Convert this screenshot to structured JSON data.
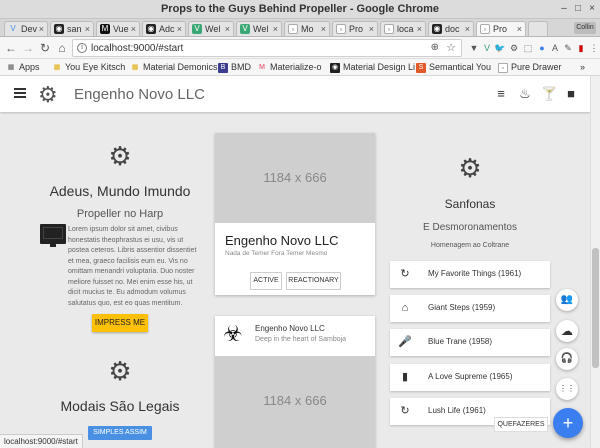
{
  "window": {
    "title": "Props to the Guys Behind Propeller - Google Chrome",
    "user": "Collin",
    "controls": [
      "–",
      "□",
      "×"
    ]
  },
  "tabs": [
    {
      "label": "Dev",
      "fav": "V",
      "fav_icon": "vuetify-icon"
    },
    {
      "label": "san",
      "fav": "◉",
      "fav_icon": "github-icon"
    },
    {
      "label": "Vue",
      "fav": "M",
      "fav_icon": "medium-icon"
    },
    {
      "label": "Adc",
      "fav": "◉",
      "fav_icon": "github-icon"
    },
    {
      "label": "Wel",
      "fav": "V",
      "fav_icon": "vue-icon"
    },
    {
      "label": "Wel",
      "fav": "V",
      "fav_icon": "vue-icon"
    },
    {
      "label": "Mo",
      "fav": "▫",
      "fav_icon": "page-icon"
    },
    {
      "label": "Pro",
      "fav": "▫",
      "fav_icon": "page-icon"
    },
    {
      "label": "loca",
      "fav": "▫",
      "fav_icon": "page-icon"
    },
    {
      "label": "doc",
      "fav": "◉",
      "fav_icon": "github-icon"
    },
    {
      "label": "Pro",
      "fav": "▫",
      "fav_icon": "page-icon",
      "active": true
    }
  ],
  "address": {
    "url": "localhost:9000/#start",
    "info": "i",
    "zoom": "⊕",
    "star": "☆"
  },
  "extensions": [
    "▼",
    "V",
    "🐦",
    "⚙",
    "⬚",
    "●",
    "A",
    "✎",
    "▮",
    "⋮"
  ],
  "bookmarks": [
    {
      "label": "Apps",
      "icon": "▦",
      "icon_name": "apps-icon"
    },
    {
      "label": "You Eye Kitsch",
      "icon": "▦",
      "icon_name": "bookmark-icon"
    },
    {
      "label": "Material Demonics",
      "icon": "▦",
      "icon_name": "bookmark-icon"
    },
    {
      "label": "BMD",
      "icon": "B",
      "icon_name": "bmd-icon"
    },
    {
      "label": "Materialize-o",
      "icon": "M",
      "icon_name": "materialize-icon"
    },
    {
      "label": "Material Design Li",
      "icon": "◉",
      "icon_name": "github-icon"
    },
    {
      "label": "Semantical You",
      "icon": "S",
      "icon_name": "semantic-icon"
    },
    {
      "label": "Pure Drawer",
      "icon": "▫",
      "icon_name": "page-icon"
    }
  ],
  "bookmarks_more": "»",
  "app": {
    "brand": "Engenho Novo LLC",
    "gear": "⚙",
    "actions": [
      {
        "glyph": "≡",
        "icon": "list-icon"
      },
      {
        "glyph": "♨",
        "icon": "scale-icon"
      },
      {
        "glyph": "🍸",
        "icon": "cocktail-icon"
      },
      {
        "glyph": "■",
        "icon": "box-icon"
      }
    ]
  },
  "left": {
    "title": "Adeus, Mundo Imundo",
    "subtitle": "Propeller no Harp",
    "lead": "Lorem ipsum dolor sit amet, civibus honestatis theophrastus ei usu, vis ut postea ceteros. Libris assentior dissentiet et mea, graeco facilisis eum eu. Vis no omittam menandri voluptaria. Duo noster meliore fuisset no. Mei enim esse his, ut dicit mucius te. Eu admodum volumus salutatus quo, est eo quas mentitum.",
    "button": "IMPRESS ME",
    "title2": "Modais São Legais",
    "button2": "SIMPLES ASSIM",
    "monitor": "▬"
  },
  "mid": {
    "image1": "1184 x 666",
    "title": "Engenho Novo LLC",
    "subtitle": "Nada de Temer Fora Temer Mesmo",
    "btn1": "ACTIVE",
    "btn2": "REACTIONARY",
    "card2_title": "Engenho Novo LLC",
    "card2_sub": "Deep in the heart of Samboja",
    "biohazard": "☣",
    "image2": "1184 x 666"
  },
  "right": {
    "title": "Sanfonas",
    "subtitle": "E Desmoronamentos",
    "caption": "Homenagem ao Coltrane",
    "items": [
      {
        "label": "My Favorite Things (1961)",
        "glyph": "↻",
        "icon": "refresh-icon"
      },
      {
        "label": "Giant Steps (1959)",
        "glyph": "⌂",
        "icon": "bank-icon"
      },
      {
        "label": "Blue Trane (1958)",
        "glyph": "🎤",
        "icon": "mic-icon"
      },
      {
        "label": "A Love Supreme (1965)",
        "glyph": "▮",
        "icon": "bar-chart-icon"
      },
      {
        "label": "Lush Life (1961)",
        "glyph": "↻",
        "icon": "refresh-icon"
      }
    ],
    "tooltip": "QUEFAZERES"
  },
  "fabs": [
    {
      "glyph": "👥",
      "icon": "group-add-icon"
    },
    {
      "glyph": "☁",
      "icon": "cloud-icon"
    },
    {
      "glyph": "🎧",
      "icon": "headset-icon"
    },
    {
      "glyph": "⋮⋮",
      "icon": "dialpad-icon"
    }
  ],
  "fab_main": "+",
  "status": "localhost:9000/#start"
}
